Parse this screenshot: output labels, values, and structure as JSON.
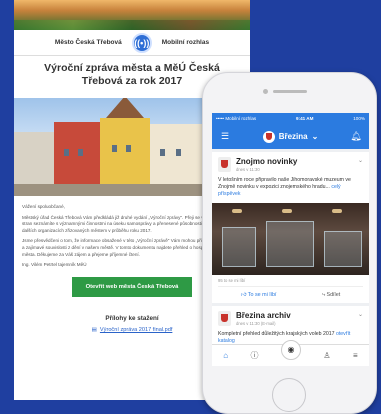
{
  "newsletter": {
    "brand_left": "Město Česká Třebová",
    "brand_right": "Mobilní rozhlas",
    "title": "Výroční zpráva města a MěÚ Česká Třebová za rok 2017",
    "greeting": "Vážení spoluobčané,",
    "paragraphs": [
      "Městský úřad Česká Třebová Vám předkládá již druhé vydání „Výroční zprávy\". Přeji se v rámci několika stran seznámíte s významnými činnostmi na úseku samosprávy a přenesené působnosti na úřadě, ale i v dalších organizacích zřizovaných městem v průběhu roku 2017.",
      "Jsme přesvědčeni o tom, že informace obsažené v této „Výroční zprávě\" Vám mohou přinést nové pohledy a zajímavé souvislosti z dění v našem městě. V tomto dokumentu najdete přehled o hospodaření i o rozvoji města. Děkujeme za Váš zájem a přejeme příjemné čtení.",
      "Ing. Vilém Petrtel tajemník MěÚ"
    ],
    "button_label": "Otevřít web města Česká Třebová",
    "attachments_title": "Přílohy ke stažení",
    "attachment_link": "Výroční zpráva 2017 final.pdf"
  },
  "phone": {
    "status": {
      "carrier": "••••• Mobilní rozhlas",
      "time": "9:41 AM",
      "battery": "100%"
    },
    "location": "Březina",
    "posts": [
      {
        "title": "Znojmo novinky",
        "meta": "dnes v 11:30",
        "body": "V letošním roce připravilo naše Jihomoravské muzeum ve Znojmě novinku v expozici znojemského hradu...",
        "link": "celý příspěvek",
        "stats": "95 to se mi líbí",
        "like_label": "To se mi líbí",
        "share_label": "Sdílet"
      },
      {
        "title": "Březina archiv",
        "meta": "dnes v 11:30 (E-mail)",
        "body": "Kompletní přehled důležitých krajských voleb 2017",
        "link": "otevřít katalog"
      }
    ]
  },
  "icons": {
    "settings": "sliders-icon",
    "notifications": "bell-icon",
    "home": "home-icon",
    "info": "info-icon",
    "camera": "camera-icon",
    "contacts": "person-icon",
    "menu": "menu-icon"
  },
  "colors": {
    "background": "#1f3fa0",
    "app_blue": "#2b7be0",
    "button_green": "#2e9a45"
  }
}
